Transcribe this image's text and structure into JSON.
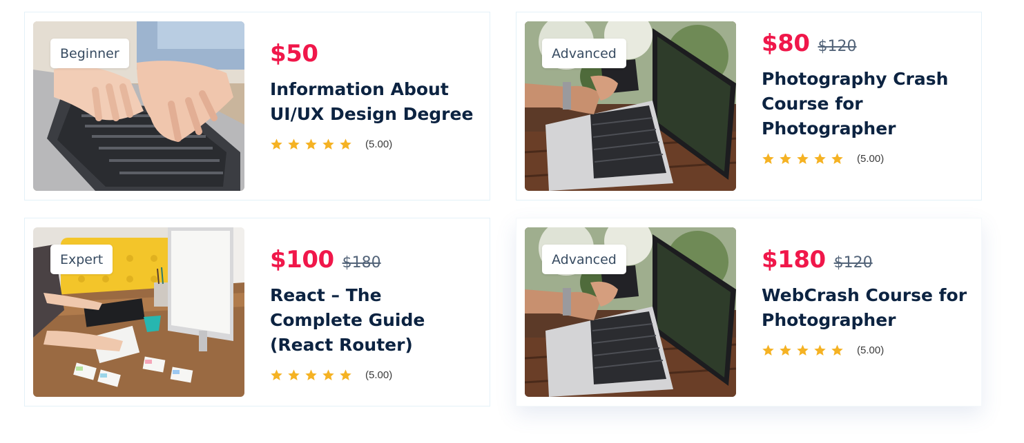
{
  "courses": [
    {
      "level": "Beginner",
      "price": "$50",
      "old_price": "",
      "title": "Information About UI/UX Design Degree",
      "rating_text": "(5.00)",
      "stars": 5
    },
    {
      "level": "Advanced",
      "price": "$80",
      "old_price": "$120",
      "title": "Photography Crash Course for Photographer",
      "rating_text": "(5.00)",
      "stars": 5
    },
    {
      "level": "Expert",
      "price": "$100",
      "old_price": "$180",
      "title": "React – The Complete Guide (React Router)",
      "rating_text": "(5.00)",
      "stars": 5
    },
    {
      "level": "Advanced",
      "price": "$180",
      "old_price": "$120",
      "title": "WebCrash Course for Photographer",
      "rating_text": "(5.00)",
      "stars": 5
    }
  ],
  "colors": {
    "price": "#f0174a",
    "title": "#0c2341",
    "star": "#f5b223",
    "card_border": "#e3f1f8"
  },
  "icons": {
    "star": "star-icon"
  }
}
